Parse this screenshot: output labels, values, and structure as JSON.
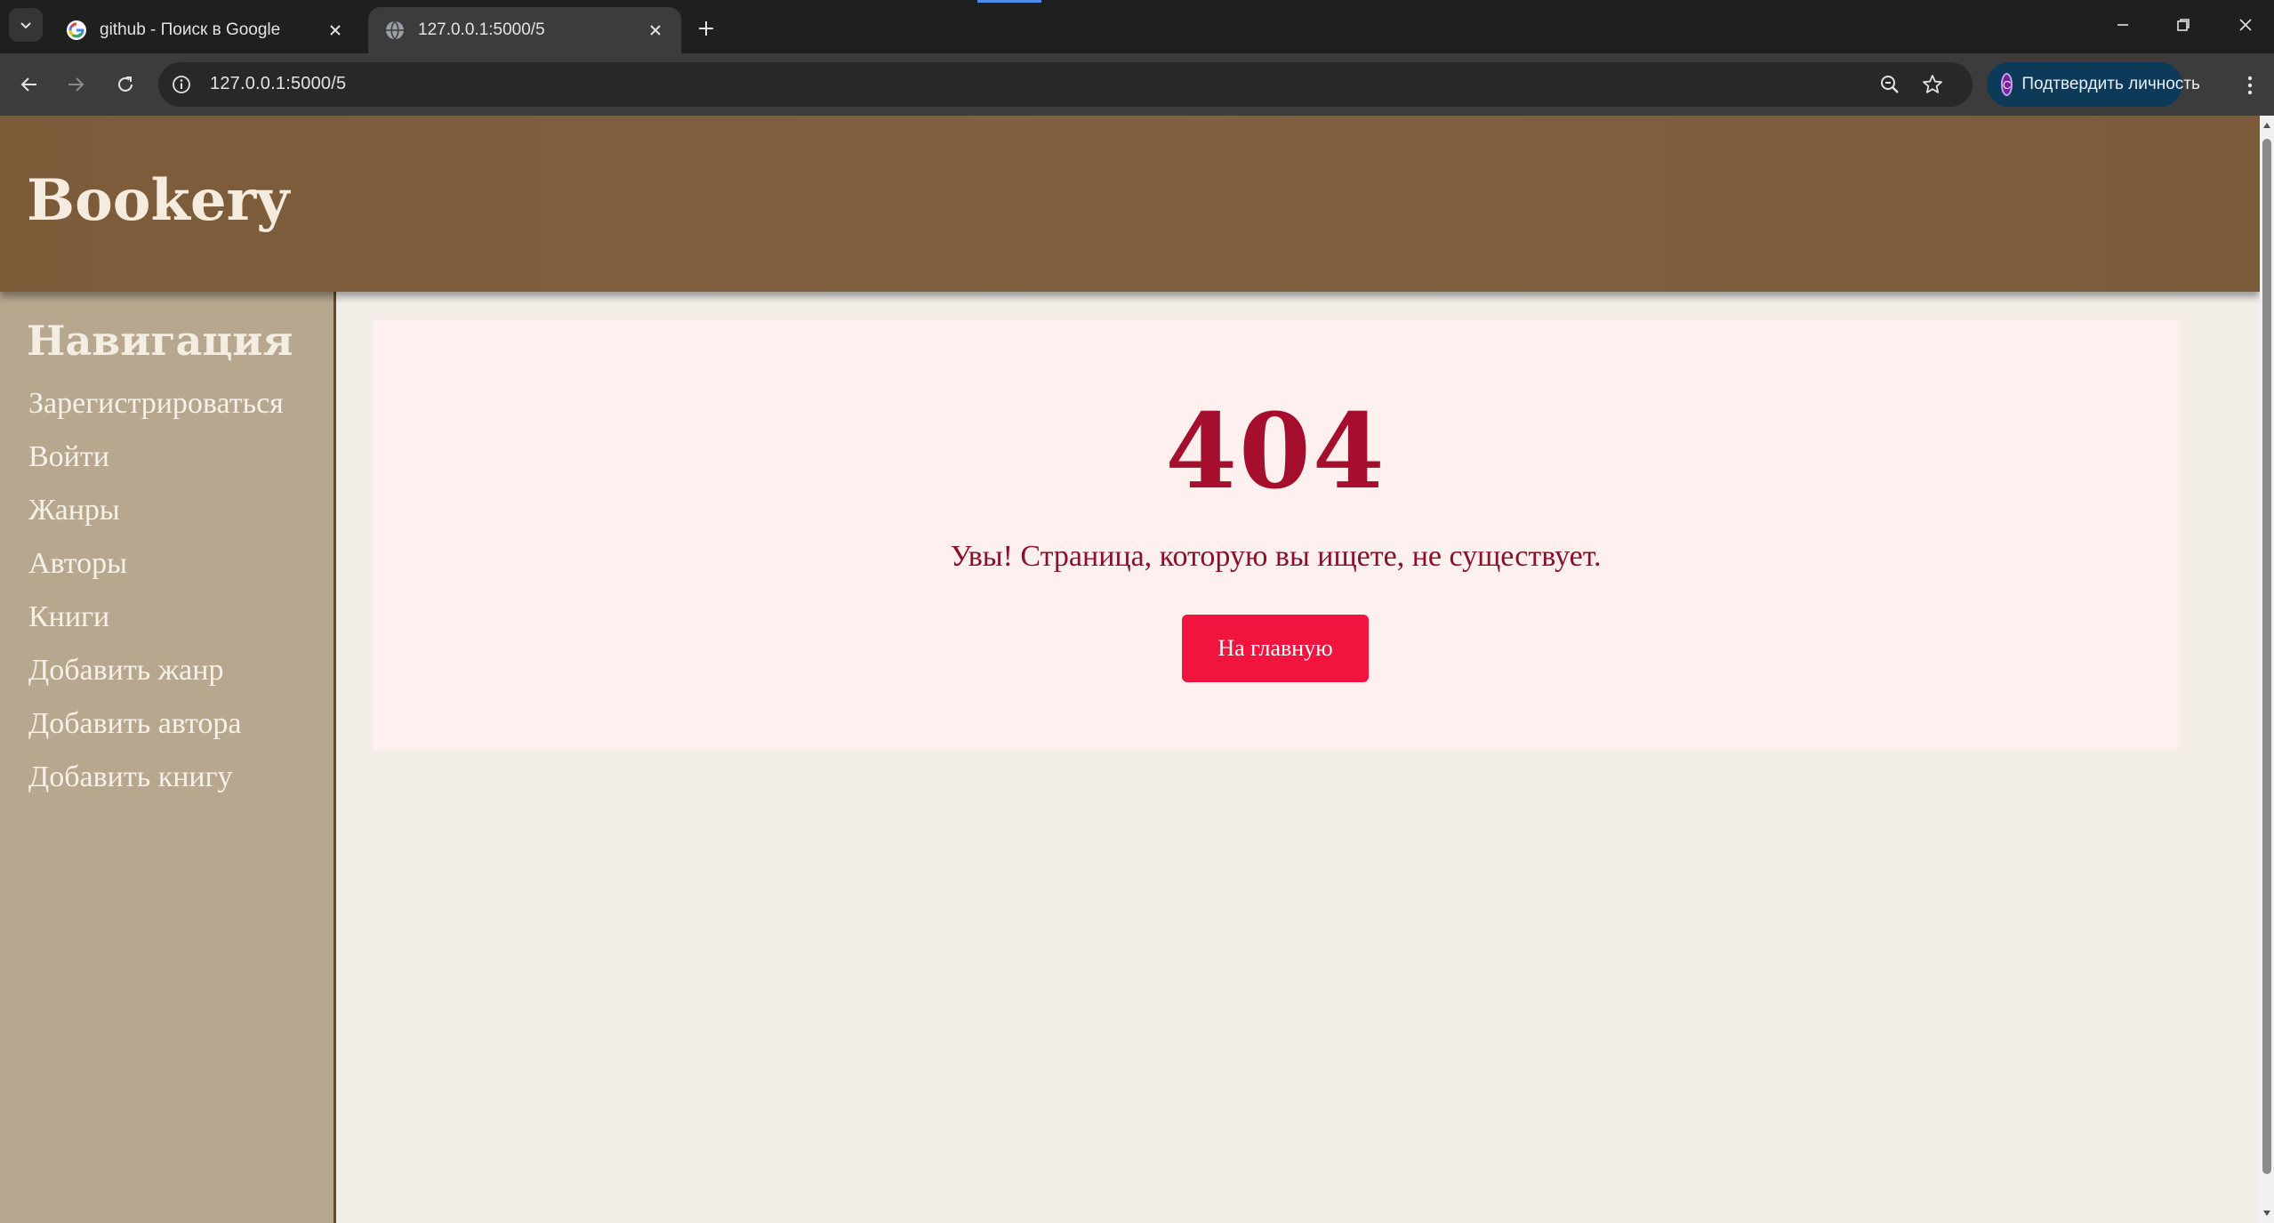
{
  "browser": {
    "tabs": [
      {
        "title": "github - Поиск в Google",
        "favicon": "google-g-icon",
        "active": false
      },
      {
        "title": "127.0.0.1:5000/5",
        "favicon": "globe-icon",
        "active": true
      }
    ],
    "address_bar": {
      "url": "127.0.0.1:5000/5"
    },
    "profile_button": {
      "avatar_letter": "C",
      "label": "Подтвердить личность"
    },
    "colors": {
      "tabstrip": "#1f1f1f",
      "toolbar": "#3c3c3c",
      "omnibox": "#282828",
      "profile": "#0e3a5a"
    }
  },
  "site": {
    "title": "Bookery",
    "colors": {
      "header": "#7f6040",
      "sidebar": "#b8a78f",
      "content_bg": "#f3efe8",
      "card_bg": "#fff0f0",
      "accent": "#f0143f",
      "error_text": "#a50f2d"
    }
  },
  "sidebar": {
    "heading": "Навигация",
    "items": [
      {
        "label": "Зарегистрироваться"
      },
      {
        "label": "Войти"
      },
      {
        "label": "Жанры"
      },
      {
        "label": "Авторы"
      },
      {
        "label": "Книги"
      },
      {
        "label": "Добавить жанр"
      },
      {
        "label": "Добавить автора"
      },
      {
        "label": "Добавить книгу"
      }
    ]
  },
  "error_page": {
    "code": "404",
    "message": "Увы! Страница, которую вы ищете, не существует.",
    "home_button": "На главную"
  }
}
